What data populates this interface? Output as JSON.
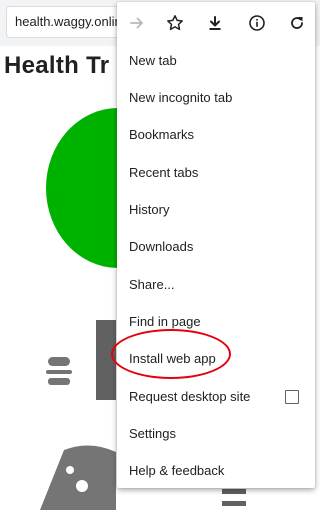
{
  "browser": {
    "url": "health.waggy.onlin"
  },
  "page": {
    "title": "Health Tr"
  },
  "menu": {
    "icons": [
      "forward-arrow-icon",
      "star-icon",
      "download-icon",
      "info-icon",
      "reload-icon"
    ],
    "items": [
      {
        "label": "New tab"
      },
      {
        "label": "New incognito tab"
      },
      {
        "label": "Bookmarks"
      },
      {
        "label": "Recent tabs"
      },
      {
        "label": "History"
      },
      {
        "label": "Downloads"
      },
      {
        "label": "Share..."
      },
      {
        "label": "Find in page"
      },
      {
        "label": "Install web app"
      },
      {
        "label": "Request desktop site",
        "checked": false
      },
      {
        "label": "Settings"
      },
      {
        "label": "Help & feedback"
      }
    ]
  },
  "colors": {
    "highlight": "#e3000f",
    "circle": "#00b200",
    "icon_gray": "#5f6368"
  }
}
